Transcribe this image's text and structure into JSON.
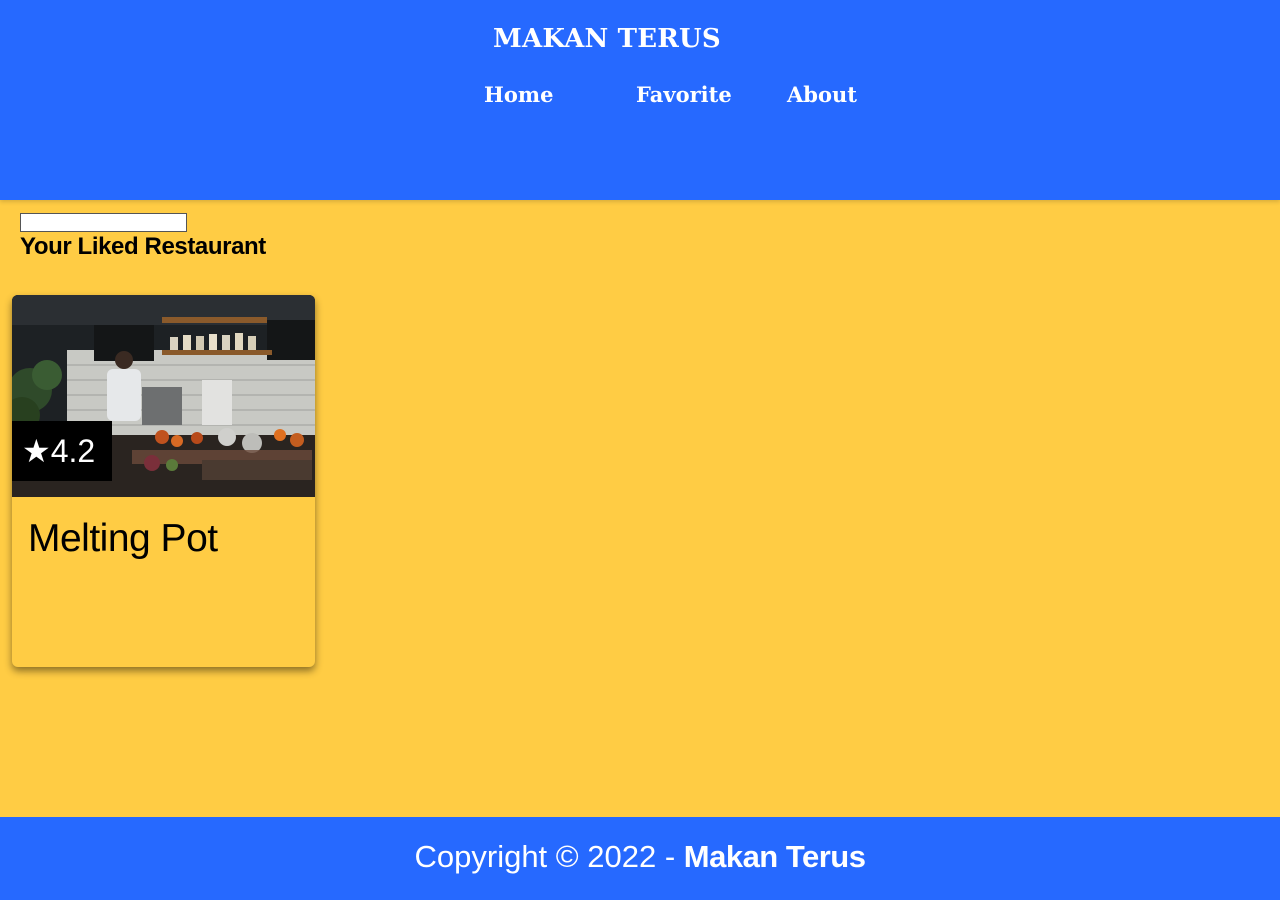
{
  "header": {
    "brand": "MAKAN TERUS",
    "nav": [
      {
        "label": "Home"
      },
      {
        "label": "Favorite"
      },
      {
        "label": "About"
      }
    ]
  },
  "main": {
    "search": {
      "value": "",
      "placeholder": ""
    },
    "section_title": "Your Liked Restaurant",
    "restaurants": [
      {
        "name": "Melting Pot",
        "rating": "4.2",
        "rating_icon": "star-icon"
      }
    ]
  },
  "footer": {
    "copyright_prefix": "Copyright © 2022 - ",
    "brand": "Makan Terus"
  },
  "colors": {
    "header_bg": "#2669FF",
    "page_bg": "#FFCC44",
    "rating_bg": "#000000"
  }
}
